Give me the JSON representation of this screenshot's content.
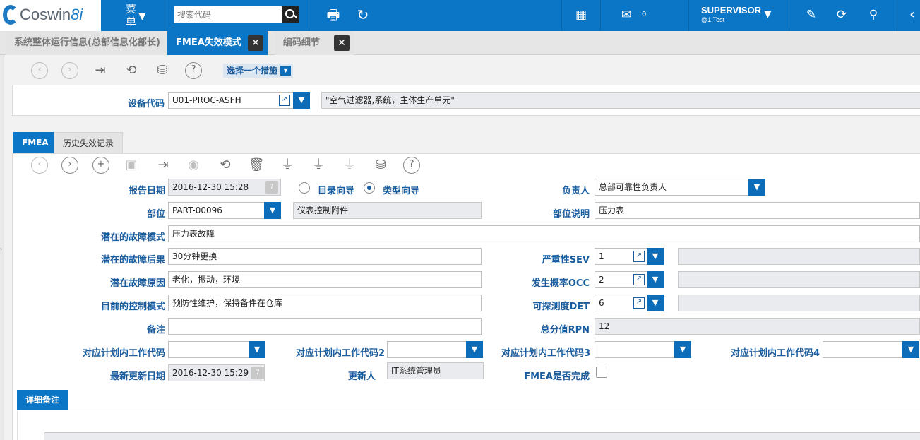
{
  "topbar": {
    "logo_text": "Coswin",
    "logo_suffix": "8i",
    "menu_label_1": "菜",
    "menu_label_2": "单",
    "search_placeholder": "搜索代码",
    "notification_count": "0",
    "user_name": "SUPERVISOR",
    "user_sub": "@1.Test",
    "icons": [
      "print-icon",
      "refresh-icon",
      "excel-icon",
      "notification-icon",
      "form-icon",
      "sync-icon",
      "location-icon",
      "chevron-left-icon"
    ]
  },
  "tabs": [
    {
      "label": "系统整体运行信息(总部信息化部长)",
      "active": false
    },
    {
      "label": "FMEA失效模式",
      "active": true
    },
    {
      "label": "编码细节",
      "active": false
    }
  ],
  "toolbar": {
    "action_select": "选择一个措施"
  },
  "equipment": {
    "label": "设备代码",
    "code": "U01-PROC-ASFH",
    "description": "\"空气过滤器,系统，主体生产单元\""
  },
  "subtabs": [
    {
      "label": "FMEA",
      "active": true
    },
    {
      "label": "历史失效记录",
      "active": false
    }
  ],
  "form": {
    "report_date_label": "报告日期",
    "report_date": "2016-12-30 15:28",
    "radio_catalog": "目录向导",
    "radio_type": "类型向导",
    "owner_label": "负责人",
    "owner": "总部可靠性负责人",
    "part_label": "部位",
    "part_code": "PART-00096",
    "part_name": "仪表控制附件",
    "part_desc_label": "部位说明",
    "part_desc": "压力表",
    "failure_mode_label": "潜在的故障模式",
    "failure_mode": "压力表故障",
    "failure_effect_label": "潜在的故障后果",
    "failure_effect": "30分钟更换",
    "failure_cause_label": "潜在故障原因",
    "failure_cause": "老化，振动，环境",
    "control_label": "目前的控制模式",
    "control": "预防性维护，保持备件在仓库",
    "note_label": "备注",
    "note": "",
    "sev_label": "严重性SEV",
    "sev": "1",
    "occ_label": "发生概率OCC",
    "occ": "2",
    "det_label": "可探测度DET",
    "det": "6",
    "rpn_label": "总分值RPN",
    "rpn": "12",
    "wc1_label": "对应计划内工作代码",
    "wc2_label": "对应计划内工作代码2",
    "wc3_label": "对应计划内工作代码3",
    "wc4_label": "对应计划内工作代码4",
    "last_update_label": "最新更新日期",
    "last_update": "2016-12-30 15:29",
    "updater_label": "更新人",
    "updater": "IT系统管理员",
    "fmea_done_label": "FMEA是否完成"
  },
  "detail": {
    "tab_label": "详细备注"
  }
}
